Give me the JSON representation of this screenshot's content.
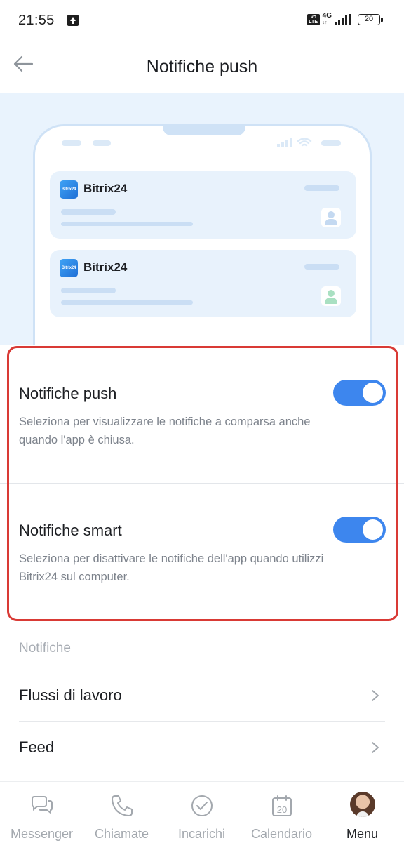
{
  "status_bar": {
    "time": "21:55",
    "network": "4G",
    "volte": "Vo LTE",
    "battery": "20"
  },
  "header": {
    "title": "Notifiche push"
  },
  "illustration": {
    "cards": [
      {
        "app_name": "Bitrix24",
        "logo_text": "Bitrix24",
        "avatar_color": "#c4d9f1"
      },
      {
        "app_name": "Bitrix24",
        "logo_text": "Bitrix24",
        "avatar_color": "#a9e0c2"
      }
    ]
  },
  "settings": [
    {
      "title": "Notifiche push",
      "description": "Seleziona per visualizzare le notifiche a comparsa anche quando l'app è chiusa.",
      "enabled": true
    },
    {
      "title": "Notifiche smart",
      "description": "Seleziona per disattivare le notifiche dell'app quando utilizzi Bitrix24 sul computer.",
      "enabled": true
    }
  ],
  "notifications_section": {
    "label": "Notifiche",
    "items": [
      {
        "label": "Flussi di lavoro"
      },
      {
        "label": "Feed"
      }
    ]
  },
  "tabbar": {
    "tabs": [
      {
        "label": "Messenger",
        "icon": "messenger-icon",
        "active": false
      },
      {
        "label": "Chiamate",
        "icon": "phone-icon",
        "active": false
      },
      {
        "label": "Incarichi",
        "icon": "check-icon",
        "active": false
      },
      {
        "label": "Calendario",
        "icon": "calendar-icon",
        "calendar_day": "20",
        "active": false
      },
      {
        "label": "Menu",
        "icon": "avatar",
        "active": true
      }
    ]
  },
  "colors": {
    "accent": "#3d86ee",
    "highlight": "#d93a35",
    "illustration_bg": "#e9f3fd"
  }
}
